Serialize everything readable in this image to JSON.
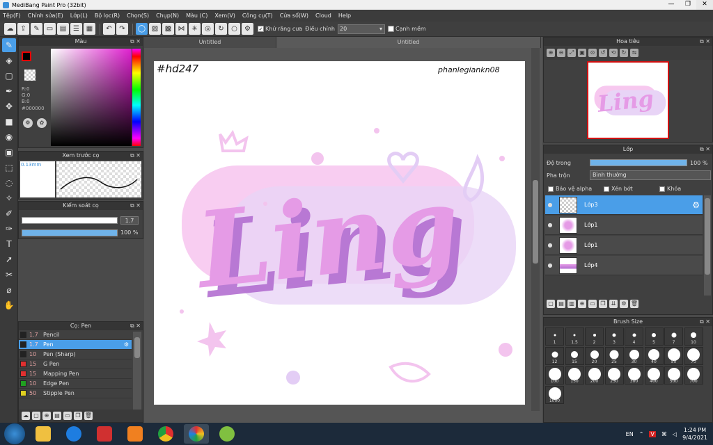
{
  "window": {
    "title": "MediBang Paint Pro (32bit)",
    "min": "—",
    "max": "❐",
    "close": "✕"
  },
  "menu": [
    "Tệp(F)",
    "Chỉnh sửa(E)",
    "Lớp(L)",
    "Bộ lọc(R)",
    "Chọn(S)",
    "Chụp(N)",
    "Màu (C)",
    "Xem(V)",
    "Công cụ(T)",
    "Cửa sổ(W)",
    "Cloud",
    "Help"
  ],
  "toolbar": {
    "antialias_label": "Khử răng cưa",
    "adjust_label": "Điều chỉnh",
    "adjust_value": "20",
    "margin_label": "Cạnh mềm"
  },
  "color_panel": {
    "title": "Màu",
    "r": "R:0",
    "g": "G:0",
    "b": "B:0",
    "hex": "#000000"
  },
  "preview_panel": {
    "title": "Xem trước cọ",
    "size": "0.13mm"
  },
  "control_panel": {
    "title": "Kiểm soát cọ",
    "size_value": "1.7",
    "size_fraction": 0.97,
    "opacity_value": "100 %",
    "opacity_fraction": 1.0
  },
  "brush_panel": {
    "title": "Cọ: Pen",
    "items": [
      {
        "size": "1.7",
        "name": "Pencil",
        "color": "#222222"
      },
      {
        "size": "1.7",
        "name": "Pen",
        "color": "#222222",
        "selected": true
      },
      {
        "size": "10",
        "name": "Pen (Sharp)",
        "color": "#222222"
      },
      {
        "size": "15",
        "name": "G Pen",
        "color": "#e03030"
      },
      {
        "size": "15",
        "name": "Mapping Pen",
        "color": "#e03030"
      },
      {
        "size": "10",
        "name": "Edge Pen",
        "color": "#20a020"
      },
      {
        "size": "50",
        "name": "Stipple Pen",
        "color": "#e0d020"
      }
    ]
  },
  "canvas": {
    "tab1": "Untitled",
    "tab2": "Untitled",
    "art_text": "Ling",
    "tag_left": "#hd247",
    "tag_right": "phanlegiankn08"
  },
  "navigator": {
    "title": "Hoa tiêu"
  },
  "layers": {
    "title": "Lớp",
    "opacity_label": "Độ trong",
    "opacity_value": "100 %",
    "opacity_fraction": 1.0,
    "blend_label": "Pha trộn",
    "blend_value": "Bình thường",
    "protect_alpha": "Bảo vệ alpha",
    "clipping": "Xén bớt",
    "lock": "Khóa",
    "items": [
      {
        "name": "Lớp3",
        "selected": true
      },
      {
        "name": "Lớp1"
      },
      {
        "name": "Lớp1"
      },
      {
        "name": "Lớp4"
      }
    ]
  },
  "brush_size": {
    "title": "Brush Size",
    "sizes": [
      "1",
      "1.5",
      "2",
      "3",
      "4",
      "5",
      "7",
      "10",
      "12",
      "15",
      "20",
      "25",
      "30",
      "40",
      "50",
      "70",
      "100",
      "150",
      "200",
      "250",
      "300",
      "400",
      "500",
      "700",
      "1000"
    ]
  },
  "taskbar": {
    "lang": "EN",
    "time": "1:24 PM",
    "date": "9/4/2021"
  },
  "colors": {
    "accent": "#4a9ee8",
    "pink_light": "#f7c8ef",
    "pink_mid": "#e59be6",
    "purple": "#b36fd1",
    "lavender": "#e3cdf5"
  }
}
